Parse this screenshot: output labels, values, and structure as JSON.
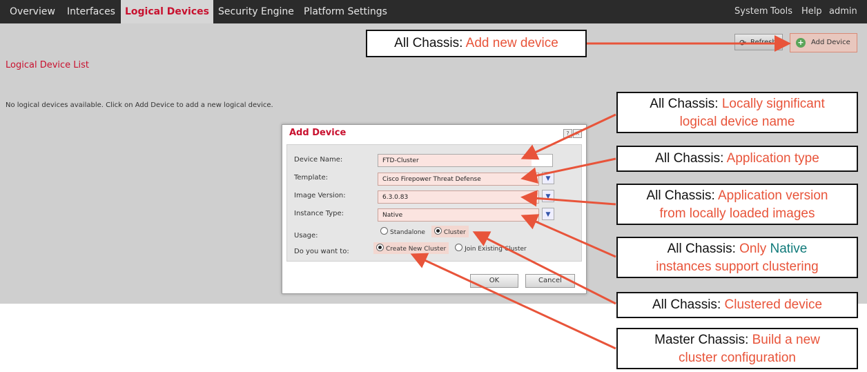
{
  "nav": {
    "tabs": [
      "Overview",
      "Interfaces",
      "Logical Devices",
      "Security Engine",
      "Platform Settings"
    ],
    "active_tab": "Logical Devices",
    "right_links": [
      "System",
      "Tools",
      "Help",
      "admin"
    ]
  },
  "toolbar": {
    "refresh_label": "Refresh",
    "add_device_label": "Add Device"
  },
  "page": {
    "list_title": "Logical Device List",
    "empty_message": "No logical devices available. Click on Add Device to add a new logical device."
  },
  "dialog": {
    "title": "Add Device",
    "help_glyph": "?",
    "close_glyph": "✕",
    "device_name_label": "Device Name:",
    "device_name_value": "FTD-Cluster",
    "template_label": "Template:",
    "template_value": "Cisco Firepower Threat Defense",
    "image_version_label": "Image Version:",
    "image_version_value": "6.3.0.83",
    "instance_type_label": "Instance Type:",
    "instance_type_value": "Native",
    "usage_label": "Usage:",
    "usage_options": [
      "Standalone",
      "Cluster"
    ],
    "usage_selected": "Cluster",
    "want_label": "Do you want to:",
    "want_options": [
      "Create New Cluster",
      "Join Existing Cluster"
    ],
    "want_selected": "Create New Cluster",
    "ok_label": "OK",
    "cancel_label": "Cancel"
  },
  "callouts": [
    {
      "key": "All Chassis",
      "sep": ":",
      "text": "Add new device"
    },
    {
      "key": "All Chassis",
      "sep": ":",
      "text_line1": "Locally significant",
      "text_line2": "logical device name"
    },
    {
      "key": "All Chassis",
      "sep": ":",
      "text": "Application type"
    },
    {
      "key": "All Chassis",
      "sep": ":",
      "text_line1": "Application version",
      "text_line2": "from locally loaded images"
    },
    {
      "key": "All Chassis",
      "sep": ":",
      "text_pre": "Only",
      "highlight": "Native",
      "text_line2": "instances support clustering"
    },
    {
      "key": "All Chassis",
      "sep": ":",
      "text": "Clustered device"
    },
    {
      "key": "Master Chassis",
      "sep": ":",
      "text_line1": "Build a new",
      "text_line2": "cluster configuration"
    }
  ],
  "colors": {
    "accent_red": "#c8102e",
    "arrow": "#e8543a",
    "native_teal": "#107a7a",
    "nav_bg": "#2b2b2b",
    "main_bg": "#cfcfcf"
  }
}
